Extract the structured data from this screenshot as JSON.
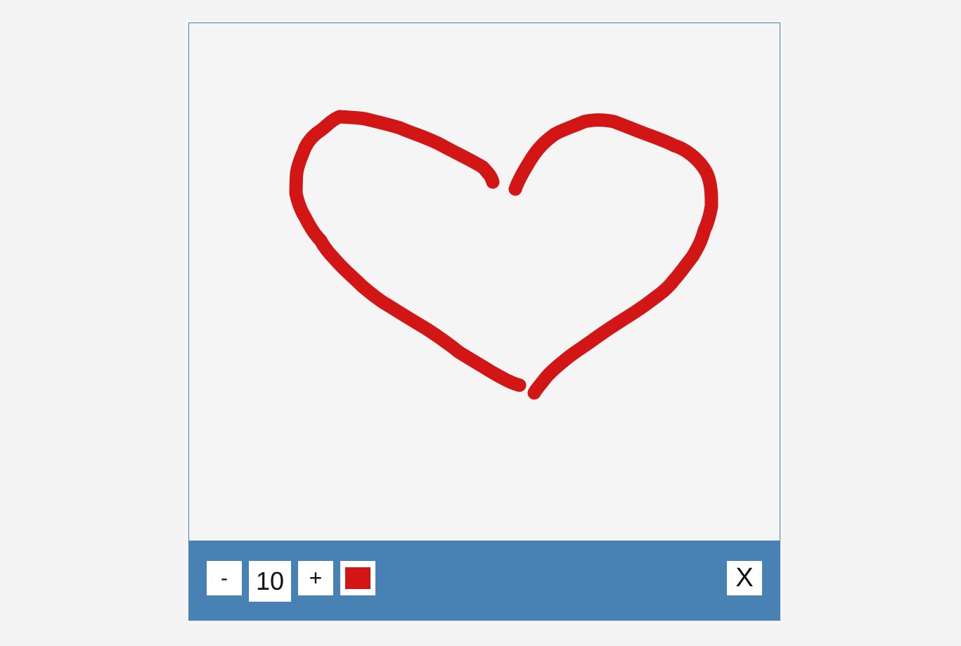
{
  "canvas": {
    "stroke_color": "#d21515",
    "brush_size": 10
  },
  "toolbar": {
    "decrease_label": "-",
    "size_value": "10",
    "increase_label": "+",
    "selected_color": "#d21515",
    "close_label": "X",
    "background_color": "#4882b4"
  }
}
